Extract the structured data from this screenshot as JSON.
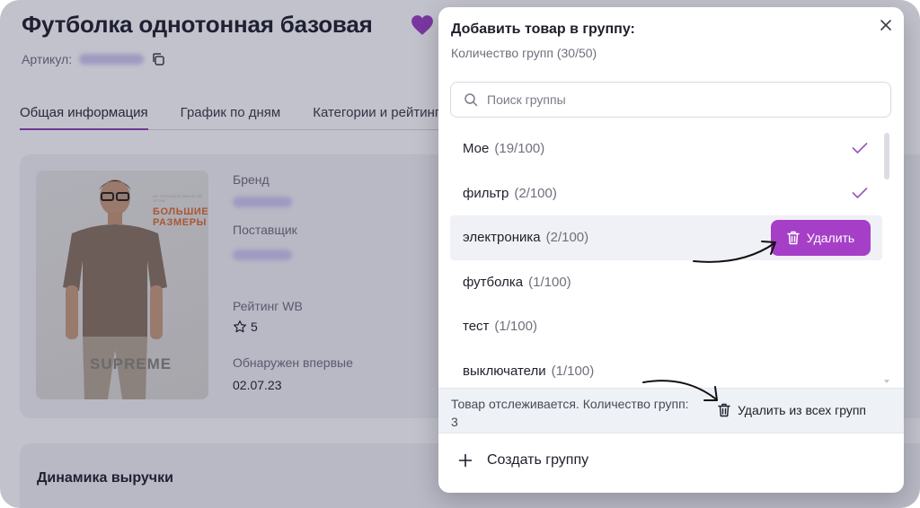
{
  "product": {
    "title": "Футболка однотонная базовая",
    "sku_label": "Артикул:",
    "tabs": [
      "Общая информация",
      "График по дням",
      "Категории и рейтинг"
    ],
    "brand_label": "Бренд",
    "supplier_label": "Поставщик",
    "rating_label": "Рейтинг WB",
    "rating_value": "5",
    "first_seen_label": "Обнаружен впервые",
    "first_seen_value": "02.07.23",
    "revenue_title": "Динамика выручки",
    "image_text": {
      "top": "НЕ ПРОСИЛИ МЕНЯ ОБ ЭТОМ",
      "big_line1": "БОЛЬШИЕ",
      "big_line2": "РАЗМЕРЫ",
      "brand": "SUPREME"
    }
  },
  "modal": {
    "title": "Добавить товар в группу:",
    "subtitle": "Количество групп (30/50)",
    "search_placeholder": "Поиск группы",
    "groups": [
      {
        "name": "Мое",
        "count": "(19/100)",
        "checked": true
      },
      {
        "name": "фильтр",
        "count": "(2/100)",
        "checked": true
      },
      {
        "name": "электроника",
        "count": "(2/100)",
        "checked": false,
        "hover": true
      },
      {
        "name": "футболка",
        "count": "(1/100)",
        "checked": false
      },
      {
        "name": "тест",
        "count": "(1/100)",
        "checked": false
      },
      {
        "name": "выключатели",
        "count": "(1/100)",
        "checked": false
      }
    ],
    "delete_label": "Удалить",
    "footer_text": "Товар отслеживается. Количество групп: 3",
    "delete_all_label": "Удалить из всех групп",
    "create_label": "Создать группу"
  },
  "colors": {
    "accent": "#a63fc8",
    "heart": "#9b3fc4",
    "tab_underline": "#8d3fb5",
    "check": "#9b5ac4"
  }
}
